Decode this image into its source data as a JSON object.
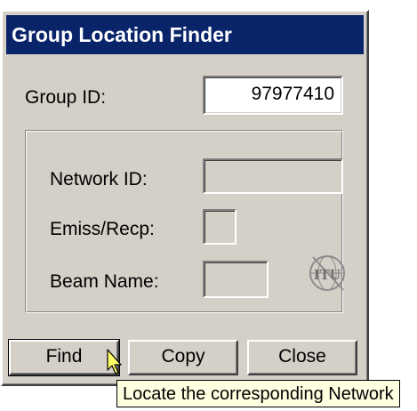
{
  "window": {
    "title": "Group Location Finder"
  },
  "fields": {
    "group_id_label": "Group ID:",
    "group_id_value": "97977410",
    "network_id_label": "Network ID:",
    "network_id_value": "",
    "emiss_recp_label": "Emiss/Recp:",
    "emiss_recp_value": "",
    "beam_name_label": "Beam Name:",
    "beam_name_value": ""
  },
  "buttons": {
    "find_label": "Find",
    "copy_label": "Copy",
    "close_label": "Close"
  },
  "tooltip": {
    "text": "Locate the corresponding Network"
  },
  "logo": {
    "icon": "itu-logo-icon",
    "text": "ITU"
  },
  "colors": {
    "titlebar": "#0a246a",
    "face": "#d4d0c8",
    "tooltip_bg": "#ffffe1"
  }
}
